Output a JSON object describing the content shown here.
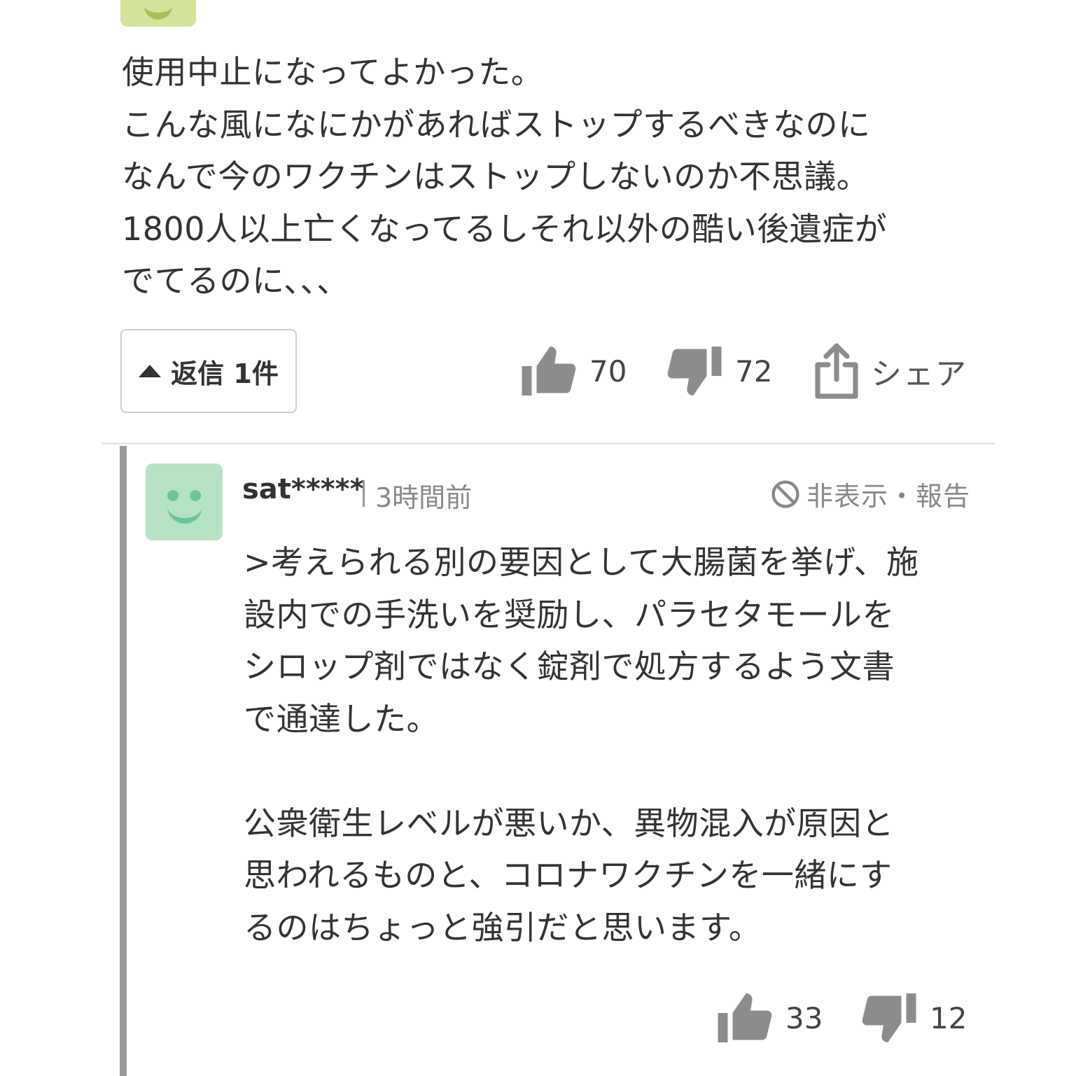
{
  "colors": {
    "text": "#333333",
    "muted": "#888888",
    "icon": "#8c8c8c",
    "parent_avatar_bg": "#d3e39b",
    "reply_avatar_bg": "#b6e2c4",
    "reply_avatar_face": "#6cc39a",
    "thread_bar": "#9b9b9b"
  },
  "parent_comment": {
    "avatar_icon": "smiley-avatar-icon",
    "body": "使用中止になってよかった。\nこんな風になにかがあればストップするべきなのに\nなんで今のワクチンはストップしないのか不思議。\n1800人以上亡くなってるしそれ以外の酷い後遺症が\nでてるのに、、、",
    "reply_button": {
      "icon": "caret-up-icon",
      "label": "返信 1件"
    },
    "likes": {
      "icon": "thumbs-up-icon",
      "count": "70"
    },
    "dislikes": {
      "icon": "thumbs-down-icon",
      "count": "72"
    },
    "share": {
      "icon": "share-icon",
      "label": "シェア"
    }
  },
  "reply_comment": {
    "avatar_icon": "smiley-avatar-icon",
    "username": "sat*****",
    "time": "3時間前",
    "report": {
      "icon": "prohibited-icon",
      "label": "非表示・報告"
    },
    "body": ">考えられる別の要因として大腸菌を挙げ、施\n設内での手洗いを奨励し、パラセタモールを\nシロップ剤ではなく錠剤で処方するよう文書\nで通達した。\n\n公衆衛生レベルが悪いか、異物混入が原因と\n思われるものと、コロナワクチンを一緒にす\nるのはちょっと強引だと思います。",
    "likes": {
      "icon": "thumbs-up-icon",
      "count": "33"
    },
    "dislikes": {
      "icon": "thumbs-down-icon",
      "count": "12"
    }
  }
}
